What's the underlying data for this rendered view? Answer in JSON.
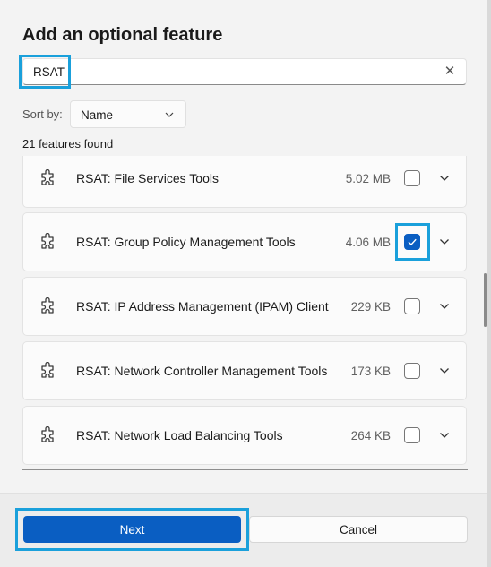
{
  "dialog": {
    "title": "Add an optional feature"
  },
  "search": {
    "value": "RSAT",
    "clear_icon": "close-icon"
  },
  "sort": {
    "label": "Sort by:",
    "selected": "Name"
  },
  "results": {
    "count_text": "21 features found"
  },
  "features": [
    {
      "name": "RSAT: File Services Tools",
      "size": "5.02 MB",
      "checked": false
    },
    {
      "name": "RSAT: Group Policy Management Tools",
      "size": "4.06 MB",
      "checked": true
    },
    {
      "name": "RSAT: IP Address Management (IPAM) Client",
      "size": "229 KB",
      "checked": false
    },
    {
      "name": "RSAT: Network Controller Management Tools",
      "size": "173 KB",
      "checked": false
    },
    {
      "name": "RSAT: Network Load Balancing Tools",
      "size": "264 KB",
      "checked": false
    }
  ],
  "footer": {
    "next_label": "Next",
    "cancel_label": "Cancel"
  },
  "colors": {
    "accent": "#0a5ec2",
    "highlight": "#1aa0db"
  }
}
